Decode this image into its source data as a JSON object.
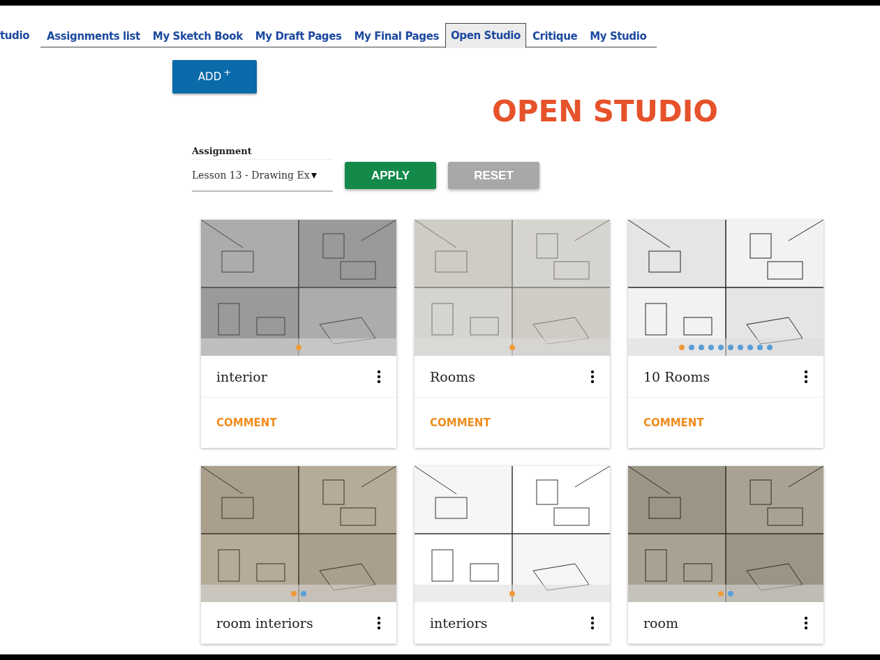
{
  "tabs": [
    {
      "label": "tudio",
      "selected": false
    },
    {
      "label": "Assignments list",
      "selected": false
    },
    {
      "label": "My Sketch Book",
      "selected": false
    },
    {
      "label": "My Draft Pages",
      "selected": false
    },
    {
      "label": "My Final Pages",
      "selected": false
    },
    {
      "label": "Open Studio",
      "selected": true
    },
    {
      "label": "Critique",
      "selected": false
    },
    {
      "label": "My Studio",
      "selected": false
    }
  ],
  "add_button": {
    "label": "ADD",
    "icon": "+"
  },
  "page_title": "OPEN STUDIO",
  "filter": {
    "label": "Assignment",
    "value": "Lesson 13 - Drawing Ex",
    "apply": "APPLY",
    "reset": "RESET"
  },
  "cards": [
    {
      "title": "interior",
      "comment": "COMMENT",
      "image": {
        "kind": "picture"
      },
      "dots": [
        {
          "selected": true
        }
      ]
    },
    {
      "title": "Rooms",
      "comment": "COMMENT",
      "image": {
        "kind": "picture"
      },
      "dots": [
        {
          "selected": true
        }
      ]
    },
    {
      "title": "10 Rooms",
      "comment": "COMMENT",
      "image": {
        "kind": "picture"
      },
      "dots": [
        {
          "selected": true
        },
        {
          "selected": false
        },
        {
          "selected": false
        },
        {
          "selected": false
        },
        {
          "selected": false
        },
        {
          "selected": false
        },
        {
          "selected": false
        },
        {
          "selected": false
        },
        {
          "selected": false
        },
        {
          "selected": false
        }
      ]
    },
    {
      "title": "room interiors",
      "image": {
        "kind": "picture"
      },
      "dots": [
        {
          "selected": true
        },
        {
          "selected": false
        }
      ]
    },
    {
      "title": "interiors",
      "image": {
        "kind": "picture"
      },
      "dots": [
        {
          "selected": true
        }
      ]
    },
    {
      "title": "room",
      "image": {
        "kind": "picture"
      },
      "dots": [
        {
          "selected": true
        },
        {
          "selected": false
        }
      ]
    }
  ]
}
